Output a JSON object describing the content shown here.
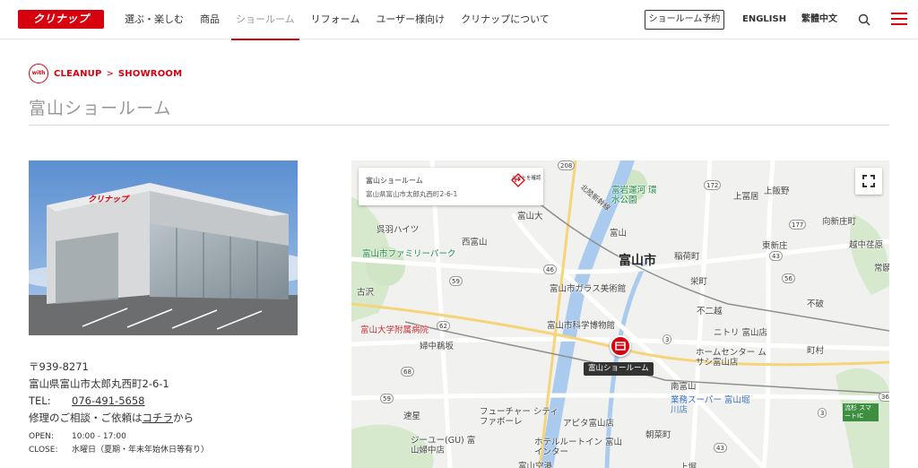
{
  "header": {
    "logo_text": "クリナップ",
    "nav": [
      "選ぶ・楽しむ",
      "商品",
      "ショールーム",
      "リフォーム",
      "ユーザー様向け",
      "クリナップについて"
    ],
    "active_nav": "ショールーム",
    "reserve_label": "ショールーム予約",
    "lang_en": "ENGLISH",
    "lang_tw": "繁體中文"
  },
  "breadcrumb": {
    "badge": "with",
    "items": [
      "CLEANUP",
      "SHOWROOM"
    ],
    "separator": ">"
  },
  "page_title": "富山ショールーム",
  "info": {
    "postal": "〒939-8271",
    "address": "富山県富山市太郎丸西町2-6-1",
    "tel_label": "TEL:",
    "tel": "076-491-5658",
    "consult_text": "修理のご相談・ご依頼は",
    "consult_link": "コチラ",
    "consult_suffix": "から",
    "open_label": "OPEN:",
    "open_value": "10:00 - 17:00",
    "close_label": "CLOSE:",
    "close_value": "水曜日（夏期・年末年始休日等有り）"
  },
  "map": {
    "card_name": "富山ショールーム",
    "card_address": "富山県富山市太郎丸西町2-6-1",
    "route_label": "ルートを確認",
    "pin_label": "富山ショールーム",
    "labels": {
      "toyama_city": "富山市",
      "toyama_dai": "富山大",
      "nishi_toyama": "西富山",
      "kureha": "呉羽ハイツ",
      "family_park": "富山市ファミリーパーク",
      "furusawa": "古沢",
      "glass_museum": "富山市ガラス美術館",
      "science_museum": "富山市科学博物館",
      "hospital": "富山大学附属病院",
      "kurehanakasaka": "婦中鵜坂",
      "hayahoshi": "速星",
      "future_city": "フューチャー シティ ファボーレ",
      "apita": "アピタ富山店",
      "hotel": "ホテルルートイン 富山インター",
      "gu": "ジーユー(GU) 富山婦中店",
      "toyama_station": "富山",
      "minami_toyama": "南富山",
      "asanamachi": "朝菜町",
      "gyomu_super": "業務スーパー 富山堀川店",
      "home_center": "ホームセンター ムサシ富山店",
      "nitori": "ニトリ 富山店",
      "fujikoshi": "不二越",
      "sakaemachi": "栄町",
      "inariimachi": "稲荷町",
      "higashishinjo": "東新庄",
      "shinjo": "向新庄町",
      "kamiiino": "上飯野",
      "kamitomii": "上冨居",
      "etchu_sakae": "越中荏原",
      "machimura": "町村",
      "fukawa": "不破",
      "kamihori": "上堀",
      "nagare": "流杉 スマートIC",
      "toyama_airport": "富山空港",
      "kansui_park": "富岩運河 環水公園",
      "joko": "常願",
      "hokuriku": "北陸新幹線",
      "toyama_airport_road": "富山空港"
    }
  }
}
